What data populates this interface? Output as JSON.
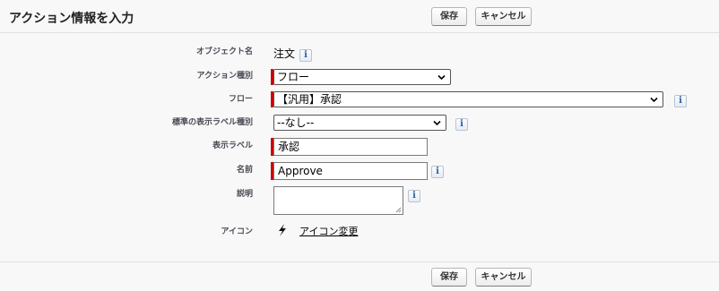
{
  "header": {
    "title": "アクション情報を入力",
    "save_label": "保存",
    "cancel_label": "キャンセル"
  },
  "form": {
    "object_label": "オブジェクト名",
    "object_value": "注文",
    "action_type_label": "アクション種別",
    "action_type_value": "フロー",
    "flow_label": "フロー",
    "flow_value": "【汎用】承認",
    "standard_label_type_label": "標準の表示ラベル種別",
    "standard_label_type_value": "--なし--",
    "display_label_label": "表示ラベル",
    "display_label_value": "承認",
    "name_label": "名前",
    "name_value": "Approve",
    "description_label": "説明",
    "description_value": "",
    "icon_label": "アイコン",
    "icon_change_label": "アイコン変更"
  },
  "info_glyph": "i",
  "footer": {
    "save_label": "保存",
    "cancel_label": "キャンセル"
  },
  "colors": {
    "required_marker": "#cc0000",
    "info_icon": "#2a5fa6"
  }
}
